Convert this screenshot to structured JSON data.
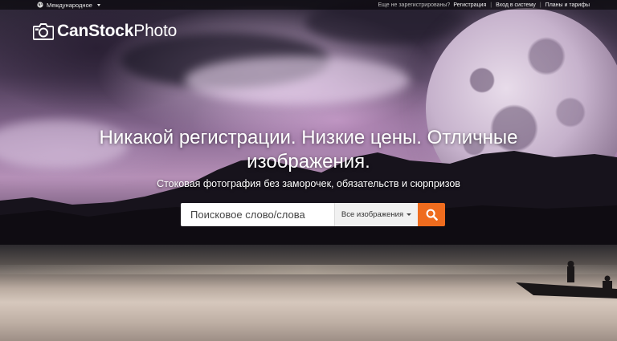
{
  "topbar": {
    "region_label": "Международное",
    "not_registered": "Еще не зарегистрированы?",
    "register": "Регистрация",
    "login": "Вход в систему",
    "plans": "Планы и тарифы",
    "separator": "|"
  },
  "logo": {
    "part_bold": "CanStock",
    "part_light": "Photo",
    "icon": "camera-icon"
  },
  "hero": {
    "headline": "Никакой регистрации. Низкие цены. Отличные изображения.",
    "subline": "Стоковая фотография без заморочек, обязательств и сюрпризов"
  },
  "search": {
    "placeholder": "Поисковое слово/слова",
    "value": "",
    "scope_selected": "Все изображения",
    "button_icon": "search-icon"
  },
  "colors": {
    "accent": "#ef6c1e",
    "topbar_bg": "rgba(0,0,0,0.55)",
    "text": "#ffffff"
  }
}
